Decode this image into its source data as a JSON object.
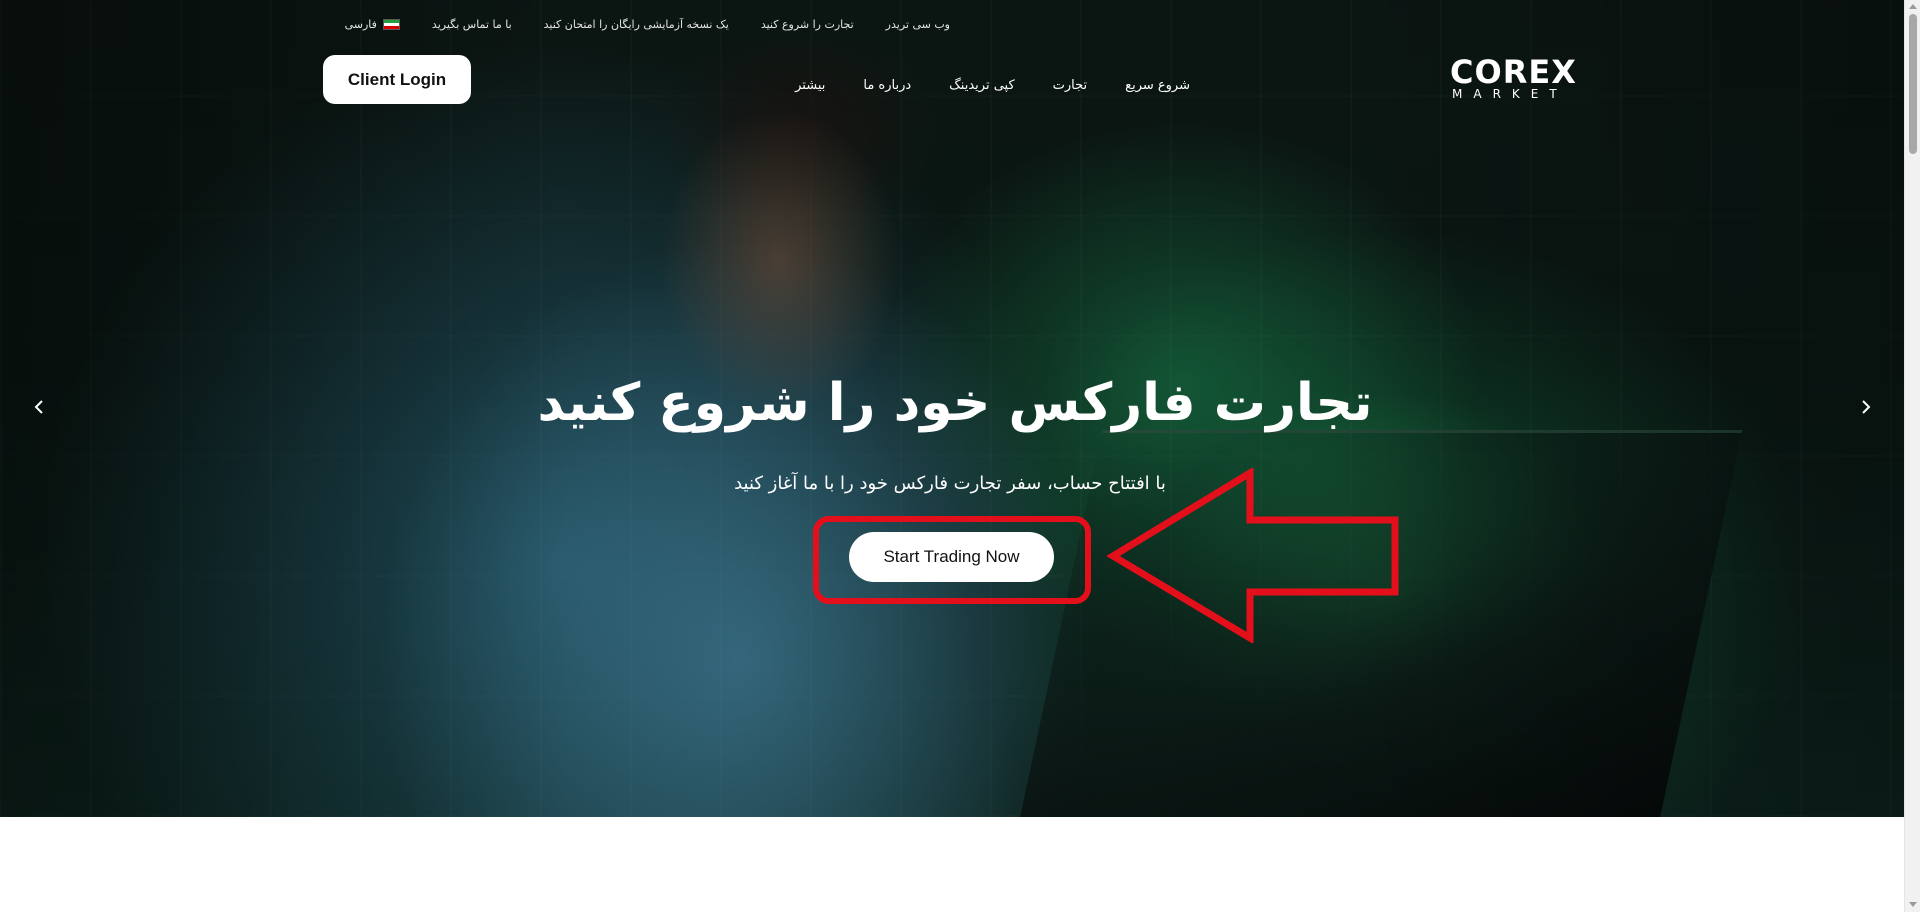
{
  "topbar": {
    "items": [
      {
        "label": "وب سی تریدر"
      },
      {
        "label": "تجارت را شروع کنید"
      },
      {
        "label": "یک نسخه آزمایشی رایگان را امتحان کنید"
      },
      {
        "label": "با ما تماس بگیرید"
      }
    ],
    "language": {
      "label": "فارسی",
      "icon": "iran-flag-icon"
    }
  },
  "logo": {
    "main": "COREX",
    "sub": "MARKET",
    "accent": "#6bd24a"
  },
  "nav": {
    "items": [
      {
        "label": "شروع سریع"
      },
      {
        "label": "تجارت"
      },
      {
        "label": "کپی تریدینگ"
      },
      {
        "label": "درباره ما"
      },
      {
        "label": "بیشتر"
      }
    ]
  },
  "header": {
    "client_login": "Client Login"
  },
  "hero": {
    "title": "تجارت فارکس خود را شروع کنید",
    "subtitle": "با افتتاح حساب، سفر تجارت فارکس خود را با ما آغاز کنید",
    "cta": "Start Trading Now",
    "prev_icon": "chevron-left-icon",
    "next_icon": "chevron-right-icon"
  },
  "annotation": {
    "color": "#e3101c"
  }
}
